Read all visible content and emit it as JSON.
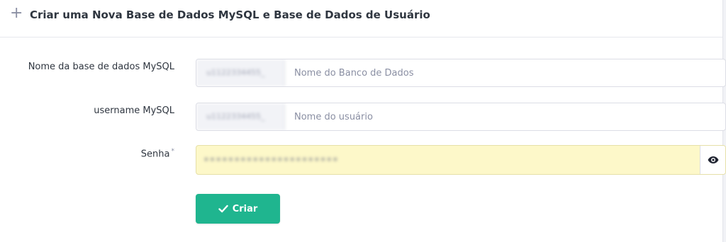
{
  "header": {
    "icon": "plus-icon",
    "title": "Criar uma Nova Base de Dados MySQL e Base de Dados de Usuário"
  },
  "form": {
    "db_name": {
      "label": "Nome da base de dados MySQL",
      "prefix": "u1122334455_",
      "placeholder": "Nome do Banco de Dados",
      "value": ""
    },
    "username": {
      "label": "username MySQL",
      "prefix": "u1122334455_",
      "placeholder": "Nome do usuário",
      "value": ""
    },
    "password": {
      "label": "Senha",
      "required_mark": "*",
      "value": "••••••••••••••••••••••",
      "toggle_icon": "eye-icon"
    },
    "submit": {
      "icon": "check-icon",
      "label": "Criar"
    }
  },
  "colors": {
    "accent": "#1fb58f",
    "password_fill": "#fdf8c9"
  }
}
